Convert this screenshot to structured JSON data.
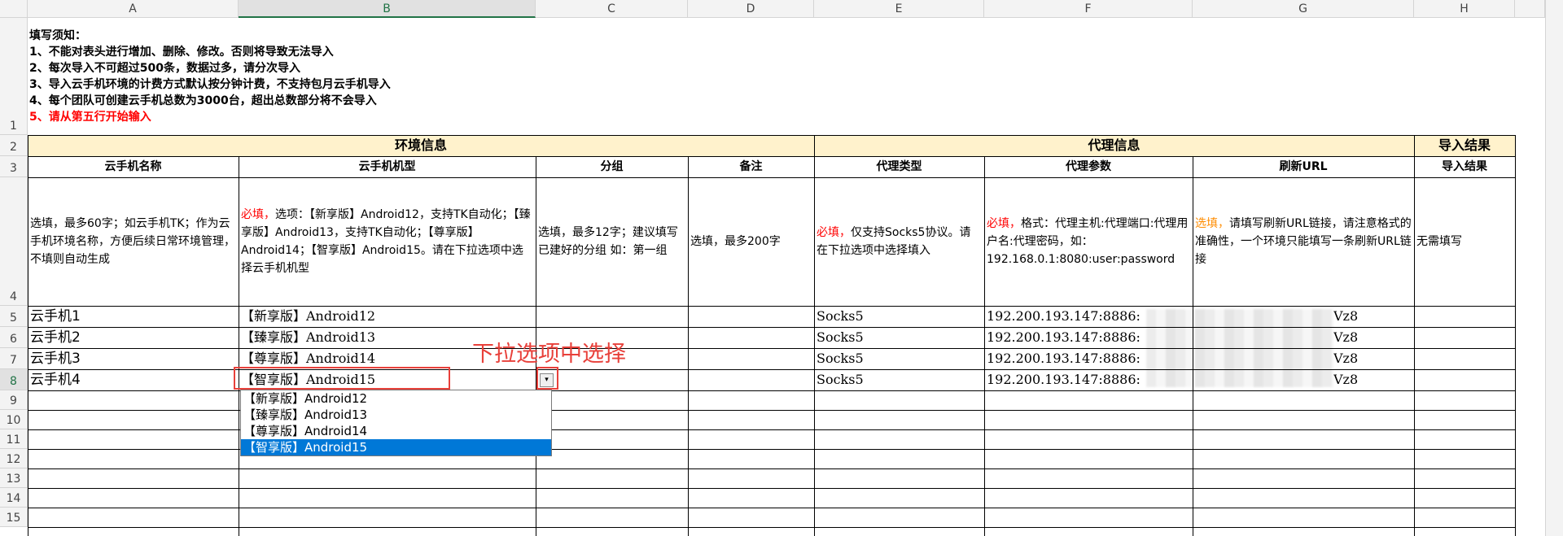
{
  "columns": [
    "A",
    "B",
    "C",
    "D",
    "E",
    "F",
    "G",
    "H"
  ],
  "rows": [
    "1",
    "2",
    "3",
    "4",
    "5",
    "6",
    "7",
    "8",
    "9",
    "10",
    "11",
    "12",
    "13",
    "14",
    "15"
  ],
  "notice": {
    "title": "填写须知：",
    "line1": "1、不能对表头进行增加、删除、修改。否则将导致无法导入",
    "line2": "2、每次导入不可超过500条，数据过多，请分次导入",
    "line3": "3、导入云手机环境的计费方式默认按分钟计费，不支持包月云手机导入",
    "line4": "4、每个团队可创建云手机总数为3000台，超出总数部分将不会导入",
    "line5": "5、请从第五行开始输入"
  },
  "groups": {
    "env": "环境信息",
    "proxy": "代理信息",
    "result": "导入结果"
  },
  "headers": {
    "name": "云手机名称",
    "model": "云手机机型",
    "group": "分组",
    "remark": "备注",
    "proxy_type": "代理类型",
    "proxy_params": "代理参数",
    "refresh_url": "刷新URL",
    "import_result": "导入结果"
  },
  "descriptions": {
    "name": "选填，最多60字；如云手机TK；作为云手机环境名称，方便后续日常环境管理，不填则自动生成",
    "model_required": "必填，",
    "model": "选项：【新享版】Android12，支持TK自动化；【臻享版】Android13，支持TK自动化；【尊享版】Android14；【智享版】Android15。请在下拉选项中选择云手机机型",
    "group": "选填，最多12字；建议填写已建好的分组 如：第一组",
    "remark": "选填，最多200字",
    "proxy_type_required": "必填，",
    "proxy_type": "仅支持Socks5协议。请在下拉选项中选择填入",
    "proxy_params_required": "必填，",
    "proxy_params": "格式：代理主机:代理端口:代理用户名:代理密码，如：192.168.0.1:8080:user:password",
    "refresh_url_optional": "选填，",
    "refresh_url": "请填写刷新URL链接，请注意格式的准确性，一个环境只能填写一条刷新URL链接",
    "import_result": "无需填写"
  },
  "data_rows": [
    {
      "name": "云手机1",
      "model": "【新享版】Android12",
      "proxy_type": "Socks5",
      "proxy_params": "192.200.193.147:8886:",
      "tail": "Vz8"
    },
    {
      "name": "云手机2",
      "model": "【臻享版】Android13",
      "proxy_type": "Socks5",
      "proxy_params": "192.200.193.147:8886:",
      "tail": "Vz8"
    },
    {
      "name": "云手机3",
      "model": "【尊享版】Android14",
      "proxy_type": "Socks5",
      "proxy_params": "192.200.193.147:8886:",
      "tail": "Vz8"
    },
    {
      "name": "云手机4",
      "model": "【智享版】Android15",
      "proxy_type": "Socks5",
      "proxy_params": "192.200.193.147:8886:",
      "tail": "Vz8"
    }
  ],
  "dropdown": {
    "options": [
      "【新享版】Android12",
      "【臻享版】Android13",
      "【尊享版】Android14",
      "【智享版】Android15"
    ],
    "selected_index": 3,
    "button_glyph": "▾"
  },
  "annotation": "下拉选项中选择",
  "colors": {
    "group_fill": "#fff2cc",
    "required_red": "#ff0000",
    "optional_orange": "#ff8c00",
    "annotation_red": "#e8403a",
    "selection_blue": "#0078d7",
    "excel_green": "#217346"
  }
}
